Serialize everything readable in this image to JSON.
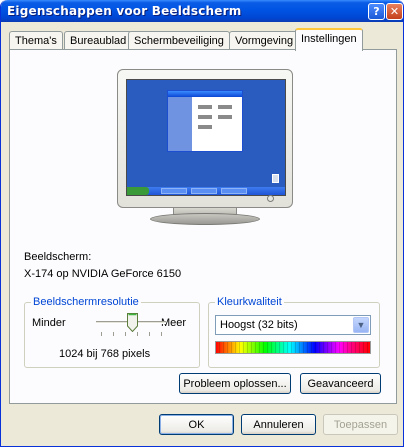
{
  "window": {
    "title": "Eigenschappen voor Beeldscherm"
  },
  "titlebar_buttons": {
    "help": "?",
    "close": "✕"
  },
  "tabs": [
    {
      "label": "Thema's"
    },
    {
      "label": "Bureaublad"
    },
    {
      "label": "Schermbeveiliging"
    },
    {
      "label": "Vormgeving"
    },
    {
      "label": "Instellingen"
    }
  ],
  "display": {
    "label": "Beeldscherm:",
    "value": "X-174 op NVIDIA GeForce 6150"
  },
  "resolution": {
    "legend": "Beeldschermresolutie",
    "min_label": "Minder",
    "max_label": "Meer",
    "value_text": "1024 bij 768 pixels"
  },
  "color_quality": {
    "legend": "Kleurkwaliteit",
    "selected": "Hoogst (32 bits)"
  },
  "buttons": {
    "troubleshoot": "Probleem oplossen...",
    "advanced": "Geavanceerd",
    "ok": "OK",
    "cancel": "Annuleren",
    "apply": "Toepassen"
  },
  "colors": {
    "titlebar": "#0054e3",
    "legend_text": "#0046d5",
    "active_tab_accent": "#ffc83c",
    "face": "#ece9d8"
  }
}
